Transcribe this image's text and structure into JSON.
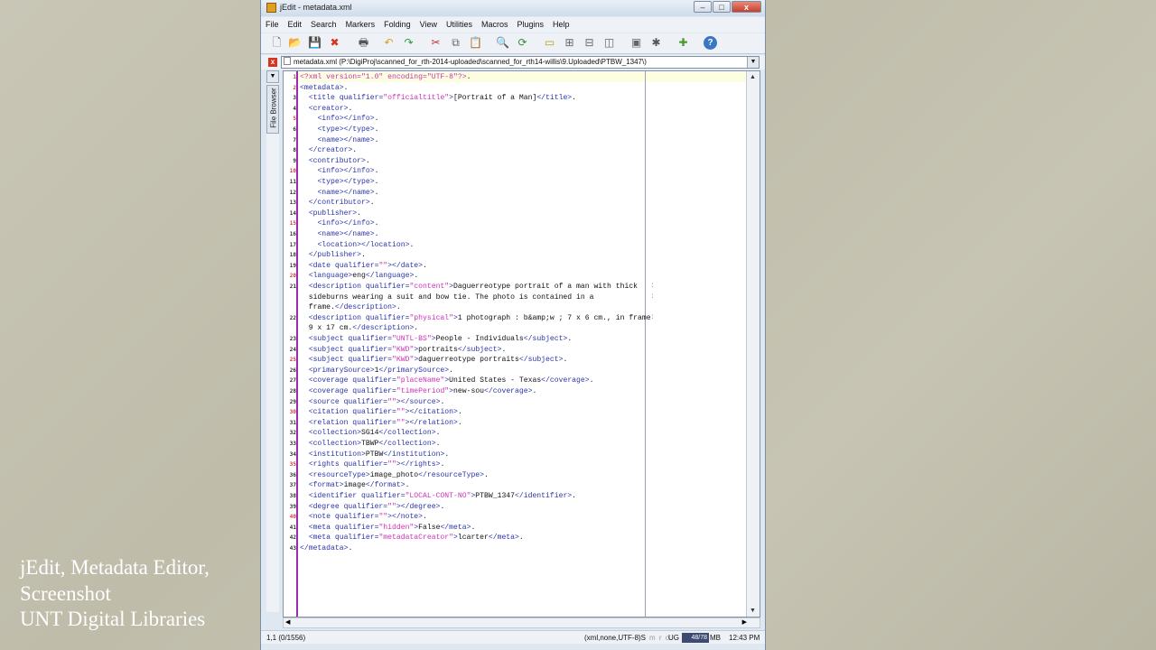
{
  "caption": {
    "line1": "jEdit, Metadata Editor,",
    "line2": "Screenshot",
    "line3": "UNT Digital Libraries"
  },
  "window": {
    "title": "jEdit - metadata.xml",
    "minimize": "–",
    "maximize": "□",
    "close": "x"
  },
  "menu": [
    "File",
    "Edit",
    "Search",
    "Markers",
    "Folding",
    "View",
    "Utilities",
    "Macros",
    "Plugins",
    "Help"
  ],
  "toolbar_icons": [
    {
      "name": "new-file-icon",
      "glyph": "🗋",
      "color": "#666"
    },
    {
      "name": "open-file-icon",
      "glyph": "📂",
      "color": "#c89a2e"
    },
    {
      "name": "save-icon",
      "glyph": "💾",
      "color": "#4a6fa5"
    },
    {
      "name": "close-buffer-icon",
      "glyph": "✖",
      "color": "#d9331f"
    },
    {
      "name": "print-icon",
      "glyph": "🖶",
      "color": "#555"
    },
    {
      "name": "undo-icon",
      "glyph": "↶",
      "color": "#d9a020"
    },
    {
      "name": "redo-icon",
      "glyph": "↷",
      "color": "#2e9a3a"
    },
    {
      "name": "cut-icon",
      "glyph": "✂",
      "color": "#c43030"
    },
    {
      "name": "copy-icon",
      "glyph": "⧉",
      "color": "#666"
    },
    {
      "name": "paste-icon",
      "glyph": "📋",
      "color": "#b88a3a"
    },
    {
      "name": "find-icon",
      "glyph": "🔍",
      "color": "#555"
    },
    {
      "name": "find-next-icon",
      "glyph": "⟳",
      "color": "#3a8a3a"
    },
    {
      "name": "new-view-icon",
      "glyph": "▭",
      "color": "#b8a020"
    },
    {
      "name": "split-icon",
      "glyph": "⊞",
      "color": "#666"
    },
    {
      "name": "unsplit-icon",
      "glyph": "⊟",
      "color": "#666"
    },
    {
      "name": "split-vertical-icon",
      "glyph": "◫",
      "color": "#666"
    },
    {
      "name": "buffer-options-icon",
      "glyph": "▣",
      "color": "#666"
    },
    {
      "name": "global-options-icon",
      "glyph": "✱",
      "color": "#555"
    },
    {
      "name": "plugin-manager-icon",
      "glyph": "✚",
      "color": "#4a9a2e"
    },
    {
      "name": "help-icon",
      "glyph": "?",
      "color": "#ffffff"
    }
  ],
  "buffer_path": "metadata.xml (P:\\DigiProj\\scanned_for_rth-2014-uploaded\\scanned_for_rth14-willis\\9.Uploaded\\PTBW_1347\\)",
  "side_tab": "File Browser",
  "code_lines": [
    {
      "n": "1",
      "fold": true,
      "segs": [
        [
          "pi",
          "<?xml version=\"1.0\" encoding=\"UTF-8\"?>"
        ],
        [
          "",
          "."
        ]
      ]
    },
    {
      "n": "2",
      "fold": true,
      "segs": [
        [
          "t",
          "<metadata>"
        ],
        [
          "",
          "."
        ]
      ]
    },
    {
      "n": "3",
      "segs": [
        [
          "",
          "  "
        ],
        [
          "t",
          "<title qualifier="
        ],
        [
          "v",
          "\"officialtitle\""
        ],
        [
          "t",
          ">"
        ],
        [
          "",
          "[Portrait of a Man]"
        ],
        [
          "t",
          "</title>"
        ],
        [
          "",
          "."
        ]
      ]
    },
    {
      "n": "4",
      "segs": [
        [
          "",
          "  "
        ],
        [
          "t",
          "<creator>"
        ],
        [
          "",
          "."
        ]
      ]
    },
    {
      "n": "5",
      "fold": true,
      "segs": [
        [
          "",
          "    "
        ],
        [
          "t",
          "<info></info>"
        ],
        [
          "",
          "."
        ]
      ]
    },
    {
      "n": "6",
      "segs": [
        [
          "",
          "    "
        ],
        [
          "t",
          "<type></type>"
        ],
        [
          "",
          "."
        ]
      ]
    },
    {
      "n": "7",
      "segs": [
        [
          "",
          "    "
        ],
        [
          "t",
          "<name></name>"
        ],
        [
          "",
          "."
        ]
      ]
    },
    {
      "n": "8",
      "segs": [
        [
          "",
          "  "
        ],
        [
          "t",
          "</creator>"
        ],
        [
          "",
          "."
        ]
      ]
    },
    {
      "n": "9",
      "segs": [
        [
          "",
          "  "
        ],
        [
          "t",
          "<contributor>"
        ],
        [
          "",
          "."
        ]
      ]
    },
    {
      "n": "10",
      "fold": true,
      "segs": [
        [
          "",
          "    "
        ],
        [
          "t",
          "<info></info>"
        ],
        [
          "",
          "."
        ]
      ]
    },
    {
      "n": "11",
      "segs": [
        [
          "",
          "    "
        ],
        [
          "t",
          "<type></type>"
        ],
        [
          "",
          "."
        ]
      ]
    },
    {
      "n": "12",
      "segs": [
        [
          "",
          "    "
        ],
        [
          "t",
          "<name></name>"
        ],
        [
          "",
          "."
        ]
      ]
    },
    {
      "n": "13",
      "segs": [
        [
          "",
          "  "
        ],
        [
          "t",
          "</contributor>"
        ],
        [
          "",
          "."
        ]
      ]
    },
    {
      "n": "14",
      "segs": [
        [
          "",
          "  "
        ],
        [
          "t",
          "<publisher>"
        ],
        [
          "",
          "."
        ]
      ]
    },
    {
      "n": "15",
      "fold": true,
      "segs": [
        [
          "",
          "    "
        ],
        [
          "t",
          "<info></info>"
        ],
        [
          "",
          "."
        ]
      ]
    },
    {
      "n": "16",
      "segs": [
        [
          "",
          "    "
        ],
        [
          "t",
          "<name></name>"
        ],
        [
          "",
          "."
        ]
      ]
    },
    {
      "n": "17",
      "segs": [
        [
          "",
          "    "
        ],
        [
          "t",
          "<location></location>"
        ],
        [
          "",
          "."
        ]
      ]
    },
    {
      "n": "18",
      "segs": [
        [
          "",
          "  "
        ],
        [
          "t",
          "</publisher>"
        ],
        [
          "",
          "."
        ]
      ]
    },
    {
      "n": "19",
      "segs": [
        [
          "",
          "  "
        ],
        [
          "t",
          "<date qualifier="
        ],
        [
          "v",
          "\"\""
        ],
        [
          "t",
          "></date>"
        ],
        [
          "",
          "."
        ]
      ]
    },
    {
      "n": "20",
      "fold": true,
      "segs": [
        [
          "",
          "  "
        ],
        [
          "t",
          "<language>"
        ],
        [
          "",
          "eng"
        ],
        [
          "t",
          "</language>"
        ],
        [
          "",
          "."
        ]
      ]
    },
    {
      "n": "21",
      "segs": [
        [
          "",
          "  "
        ],
        [
          "t",
          "<description qualifier="
        ],
        [
          "v",
          "\"content\""
        ],
        [
          "t",
          ">"
        ],
        [
          "",
          "Daguerreotype portrait of a man with thick"
        ]
      ]
    },
    {
      "n": "",
      "segs": [
        [
          "",
          "  sideburns wearing a suit and bow tie. The photo is contained in a"
        ]
      ]
    },
    {
      "n": "",
      "segs": [
        [
          "",
          "  frame."
        ],
        [
          "t",
          "</description>"
        ],
        [
          "",
          "."
        ]
      ]
    },
    {
      "n": "22",
      "segs": [
        [
          "",
          "  "
        ],
        [
          "t",
          "<description qualifier="
        ],
        [
          "v",
          "\"physical\""
        ],
        [
          "t",
          ">"
        ],
        [
          "",
          "1 photograph : b&amp;w ; 7 x 6 cm., in frame"
        ]
      ]
    },
    {
      "n": "",
      "segs": [
        [
          "",
          "  9 x 17 cm."
        ],
        [
          "t",
          "</description>"
        ],
        [
          "",
          "."
        ]
      ]
    },
    {
      "n": "23",
      "segs": [
        [
          "",
          "  "
        ],
        [
          "t",
          "<subject qualifier="
        ],
        [
          "v",
          "\"UNTL-BS\""
        ],
        [
          "t",
          ">"
        ],
        [
          "",
          "People - Individuals"
        ],
        [
          "t",
          "</subject>"
        ],
        [
          "",
          "."
        ]
      ]
    },
    {
      "n": "24",
      "segs": [
        [
          "",
          "  "
        ],
        [
          "t",
          "<subject qualifier="
        ],
        [
          "v",
          "\"KWD\""
        ],
        [
          "t",
          ">"
        ],
        [
          "",
          "portraits"
        ],
        [
          "t",
          "</subject>"
        ],
        [
          "",
          "."
        ]
      ]
    },
    {
      "n": "25",
      "fold": true,
      "segs": [
        [
          "",
          "  "
        ],
        [
          "t",
          "<subject qualifier="
        ],
        [
          "v",
          "\"KWD\""
        ],
        [
          "t",
          ">"
        ],
        [
          "",
          "daguerreotype portraits"
        ],
        [
          "t",
          "</subject>"
        ],
        [
          "",
          "."
        ]
      ]
    },
    {
      "n": "26",
      "segs": [
        [
          "",
          "  "
        ],
        [
          "t",
          "<primarySource>"
        ],
        [
          "",
          "1"
        ],
        [
          "t",
          "</primarySource>"
        ],
        [
          "",
          "."
        ]
      ]
    },
    {
      "n": "27",
      "segs": [
        [
          "",
          "  "
        ],
        [
          "t",
          "<coverage qualifier="
        ],
        [
          "v",
          "\"placeName\""
        ],
        [
          "t",
          ">"
        ],
        [
          "",
          "United States - Texas"
        ],
        [
          "t",
          "</coverage>"
        ],
        [
          "",
          "."
        ]
      ]
    },
    {
      "n": "28",
      "segs": [
        [
          "",
          "  "
        ],
        [
          "t",
          "<coverage qualifier="
        ],
        [
          "v",
          "\"timePeriod\""
        ],
        [
          "t",
          ">"
        ],
        [
          "",
          "new-sou"
        ],
        [
          "t",
          "</coverage>"
        ],
        [
          "",
          "."
        ]
      ]
    },
    {
      "n": "29",
      "segs": [
        [
          "",
          "  "
        ],
        [
          "t",
          "<source qualifier="
        ],
        [
          "v",
          "\"\""
        ],
        [
          "t",
          "></source>"
        ],
        [
          "",
          "."
        ]
      ]
    },
    {
      "n": "30",
      "fold": true,
      "segs": [
        [
          "",
          "  "
        ],
        [
          "t",
          "<citation qualifier="
        ],
        [
          "v",
          "\"\""
        ],
        [
          "t",
          "></citation>"
        ],
        [
          "",
          "."
        ]
      ]
    },
    {
      "n": "31",
      "segs": [
        [
          "",
          "  "
        ],
        [
          "t",
          "<relation qualifier="
        ],
        [
          "v",
          "\"\""
        ],
        [
          "t",
          "></relation>"
        ],
        [
          "",
          "."
        ]
      ]
    },
    {
      "n": "32",
      "segs": [
        [
          "",
          "  "
        ],
        [
          "t",
          "<collection>"
        ],
        [
          "",
          "SG14"
        ],
        [
          "t",
          "</collection>"
        ],
        [
          "",
          "."
        ]
      ]
    },
    {
      "n": "33",
      "segs": [
        [
          "",
          "  "
        ],
        [
          "t",
          "<collection>"
        ],
        [
          "",
          "TBWP"
        ],
        [
          "t",
          "</collection>"
        ],
        [
          "",
          "."
        ]
      ]
    },
    {
      "n": "34",
      "segs": [
        [
          "",
          "  "
        ],
        [
          "t",
          "<institution>"
        ],
        [
          "",
          "PTBW"
        ],
        [
          "t",
          "</institution>"
        ],
        [
          "",
          "."
        ]
      ]
    },
    {
      "n": "35",
      "fold": true,
      "segs": [
        [
          "",
          "  "
        ],
        [
          "t",
          "<rights qualifier="
        ],
        [
          "v",
          "\"\""
        ],
        [
          "t",
          "></rights>"
        ],
        [
          "",
          "."
        ]
      ]
    },
    {
      "n": "36",
      "segs": [
        [
          "",
          "  "
        ],
        [
          "t",
          "<resourceType>"
        ],
        [
          "",
          "image_photo"
        ],
        [
          "t",
          "</resourceType>"
        ],
        [
          "",
          "."
        ]
      ]
    },
    {
      "n": "37",
      "segs": [
        [
          "",
          "  "
        ],
        [
          "t",
          "<format>"
        ],
        [
          "",
          "image"
        ],
        [
          "t",
          "</format>"
        ],
        [
          "",
          "."
        ]
      ]
    },
    {
      "n": "38",
      "segs": [
        [
          "",
          "  "
        ],
        [
          "t",
          "<identifier qualifier="
        ],
        [
          "v",
          "\"LOCAL-CONT-NO\""
        ],
        [
          "t",
          ">"
        ],
        [
          "",
          "PTBW_1347"
        ],
        [
          "t",
          "</identifier>"
        ],
        [
          "",
          "."
        ]
      ]
    },
    {
      "n": "39",
      "segs": [
        [
          "",
          "  "
        ],
        [
          "t",
          "<degree qualifier="
        ],
        [
          "v",
          "\"\""
        ],
        [
          "t",
          "></degree>"
        ],
        [
          "",
          "."
        ]
      ]
    },
    {
      "n": "40",
      "fold": true,
      "segs": [
        [
          "",
          "  "
        ],
        [
          "t",
          "<note qualifier="
        ],
        [
          "v",
          "\"\""
        ],
        [
          "t",
          "></note>"
        ],
        [
          "",
          "."
        ]
      ]
    },
    {
      "n": "41",
      "segs": [
        [
          "",
          "  "
        ],
        [
          "t",
          "<meta qualifier="
        ],
        [
          "v",
          "\"hidden\""
        ],
        [
          "t",
          ">"
        ],
        [
          "",
          "False"
        ],
        [
          "t",
          "</meta>"
        ],
        [
          "",
          "."
        ]
      ]
    },
    {
      "n": "42",
      "segs": [
        [
          "",
          "  "
        ],
        [
          "t",
          "<meta qualifier="
        ],
        [
          "v",
          "\"metadataCreator\""
        ],
        [
          "t",
          ">"
        ],
        [
          "",
          "lcarter"
        ],
        [
          "t",
          "</meta>"
        ],
        [
          "",
          "."
        ]
      ]
    },
    {
      "n": "43",
      "segs": [
        [
          "t",
          "</metadata>"
        ],
        [
          "",
          "."
        ]
      ]
    }
  ],
  "wrap_markers": [
    ":",
    ":",
    ":"
  ],
  "status": {
    "position": "1,1 (0/1556)",
    "mode": "(xml,none,UTF-8)S",
    "flags": "m r o",
    "ug": "UG",
    "memory": "48/78",
    "mb": "MB",
    "time": "12:43 PM"
  },
  "colors": {
    "tag": "#2a34a8",
    "attr_value": "#cc32b8",
    "gutter_line": "#9c2bb4",
    "memory_bar": "#3d4b73"
  }
}
